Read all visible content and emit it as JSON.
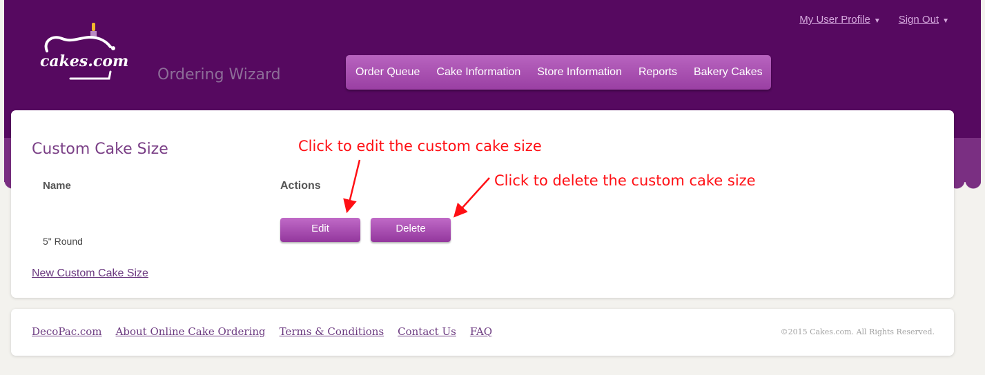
{
  "header": {
    "logo_text": "cakes.com",
    "wizard_title": "Ordering Wizard",
    "user_menu": [
      {
        "label": "My User Profile"
      },
      {
        "label": "Sign Out"
      }
    ],
    "nav": [
      {
        "label": "Order Queue"
      },
      {
        "label": "Cake Information"
      },
      {
        "label": "Store Information"
      },
      {
        "label": "Reports"
      },
      {
        "label": "Bakery Cakes"
      }
    ]
  },
  "main": {
    "title": "Custom Cake Size",
    "columns": {
      "name": "Name",
      "actions": "Actions"
    },
    "rows": [
      {
        "name": "5\" Round",
        "edit_label": "Edit",
        "delete_label": "Delete"
      }
    ],
    "new_link": "New Custom Cake Size"
  },
  "annotations": {
    "edit": "Click to edit the custom cake size",
    "delete": "Click to delete the custom cake size",
    "color": "#ff0f14"
  },
  "footer": {
    "links": [
      {
        "label": "DecoPac.com"
      },
      {
        "label": "About Online Cake Ordering"
      },
      {
        "label": "Terms & Conditions"
      },
      {
        "label": "Contact Us"
      },
      {
        "label": "FAQ"
      }
    ],
    "copyright": "©2015 Cakes.com. All Rights Reserved."
  },
  "colors": {
    "header_bg": "#560960",
    "nav_bg": "#a74db0",
    "button_bg": "#a64aae",
    "title_text": "#7a3f86"
  },
  "icons": {
    "logo": "cake-logo-icon",
    "dropdown": "caret-down-icon"
  }
}
